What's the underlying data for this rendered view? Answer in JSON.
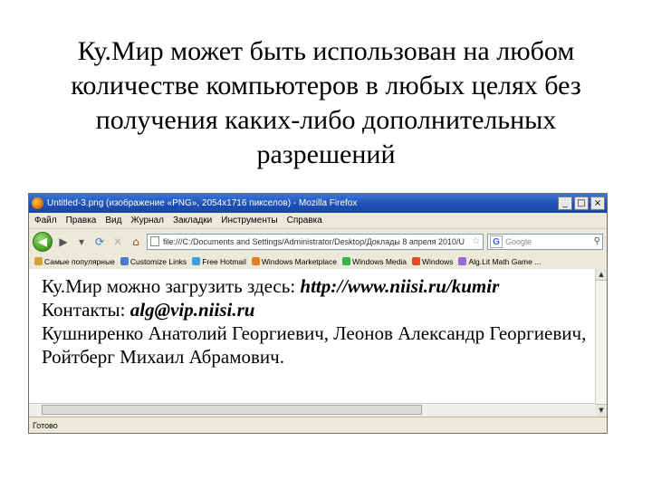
{
  "slide": {
    "title_lines": [
      "Ку.Мир может быть использован на любом",
      "количестве компьютеров в любых целях без",
      "получения каких-либо дополнительных",
      "разрешений"
    ]
  },
  "browser": {
    "window_title": "Untitled-3.png (изображение «PNG», 2054x1716 пикселов) - Mozilla Firefox",
    "window_buttons": [
      "_",
      "□",
      "×"
    ],
    "menu": [
      "Файл",
      "Правка",
      "Вид",
      "Журнал",
      "Закладки",
      "Инструменты",
      "Справка"
    ],
    "url": "file:///C:/Documents and Settings/Administrator/Desktop/Доклады 8 апреля 2010/U",
    "search_placeholder": "Google",
    "bookmarks": [
      {
        "label": "Самые популярные",
        "color": "#d9a13a"
      },
      {
        "label": "Customize Links",
        "color": "#4a7bd0"
      },
      {
        "label": "Free Hotmail",
        "color": "#3aa0d9"
      },
      {
        "label": "Windows Marketplace",
        "color": "#e08020"
      },
      {
        "label": "Windows Media",
        "color": "#3ab04a"
      },
      {
        "label": "Windows",
        "color": "#e04a2a"
      },
      {
        "label": "Alg.Lit Math Game ...",
        "color": "#9a6ad0"
      }
    ],
    "status": "Готово"
  },
  "content": {
    "line1_text": "Ку.Мир можно загрузить здесь: ",
    "line1_link": "http://www.niisi.ru/kumir",
    "line2_text": "Контакты: ",
    "line2_email": "alg@vip.niisi.ru",
    "line3": "Кушниренко Анатолий Георгиевич, Леонов Александр Георгиевич,",
    "line4": "Ройтберг Михаил Абрамович."
  }
}
